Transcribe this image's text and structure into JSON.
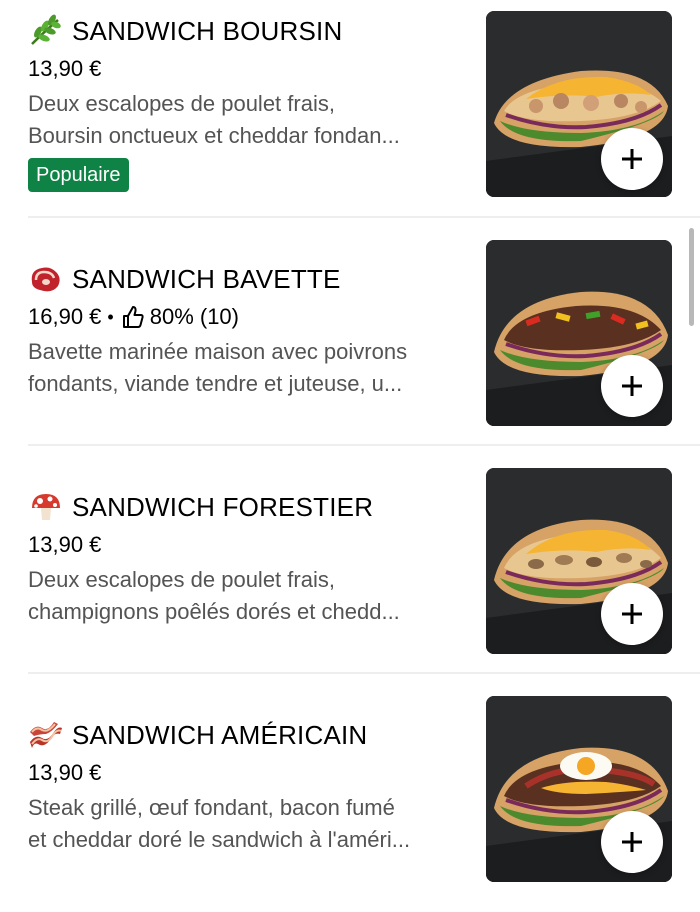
{
  "menu_items": [
    {
      "title": "SANDWICH BOURSIN",
      "emoji": "herb-icon",
      "price": "13,90 €",
      "desc_line1": "Deux escalopes de poulet frais,",
      "desc_line2": "Boursin onctueux et cheddar fondan...",
      "badge": "Populaire",
      "filling": "chicken-cheese"
    },
    {
      "title": "SANDWICH BAVETTE",
      "emoji": "steak-icon",
      "price": "16,90 €",
      "separator": "•",
      "rating": "80% (10)",
      "desc_line1": "Bavette marinée maison avec poivrons",
      "desc_line2": "fondants, viande tendre et juteuse, u...",
      "filling": "beef-peppers"
    },
    {
      "title": "SANDWICH FORESTIER",
      "emoji": "mushroom-icon",
      "price": "13,90 €",
      "desc_line1": "Deux escalopes de poulet frais,",
      "desc_line2": "champignons poêlés dorés et chedd...",
      "filling": "chicken-mushroom"
    },
    {
      "title": "SANDWICH AMÉRICAIN",
      "emoji": "bacon-icon",
      "price": "13,90 €",
      "desc_line1": "Steak grillé, œuf fondant, bacon fumé",
      "desc_line2": "et cheddar doré le sandwich à l'améri...",
      "filling": "steak-egg"
    }
  ],
  "add_label": "+",
  "colors": {
    "badge_green": "#0e8345",
    "text_secondary": "#545454",
    "photo_bg": "#2b2c2e"
  }
}
